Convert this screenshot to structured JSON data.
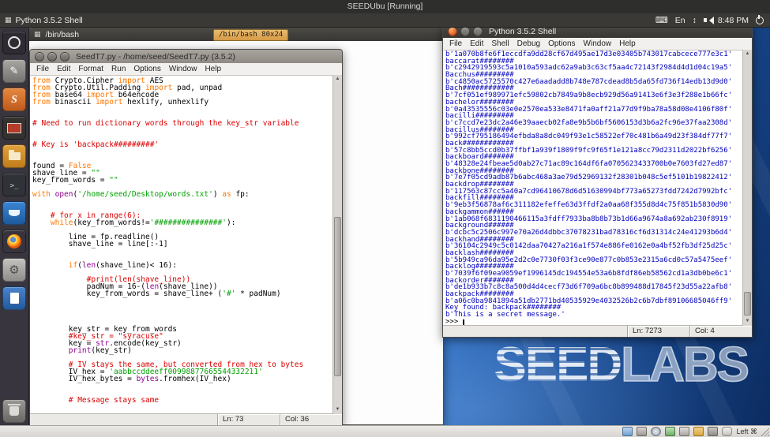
{
  "colors": {
    "kw": "#ff7700",
    "str": "#00a000",
    "com": "#dd0000",
    "blt": "#900090",
    "stdout": "#0000bb"
  },
  "icons": {
    "grid": "▦",
    "keyboard": "⌨",
    "updown": "↕",
    "arrow_up": "▲",
    "arrow_down": "▼"
  },
  "vbox": {
    "title": "SEEDUbu [Running]",
    "status_icons": [
      "display",
      "hdd",
      "cd",
      "network",
      "usb",
      "shared-folder",
      "webcam",
      "mouse"
    ],
    "input_label": "Left ⌘"
  },
  "panel": {
    "active_app": "Python 3.5.2 Shell",
    "language": "En",
    "time": "8:48 PM"
  },
  "launcher": {
    "items": [
      "dash-home",
      "text-editor",
      "seed-app",
      "code-editor",
      "files",
      "terminal",
      "wireshark",
      "firefox",
      "settings",
      "libreoffice",
      "trash"
    ]
  },
  "desktop": {
    "logo_left": "SEED",
    "logo_right": "LABS"
  },
  "terminal": {
    "title": "/bin/bash",
    "resize_tooltip": "/bin/bash 80x24"
  },
  "editor": {
    "title": "SeedT7.py - /home/seed/SeedT7.py (3.5.2)",
    "menus": [
      "File",
      "Edit",
      "Format",
      "Run",
      "Options",
      "Window",
      "Help"
    ],
    "status_line": "Ln: 73",
    "status_col": "Col: 36",
    "code_lines": [
      [
        [
          "from ",
          "k"
        ],
        [
          "Crypto.Cipher ",
          "p"
        ],
        [
          "import ",
          "k"
        ],
        [
          "AES",
          "p"
        ]
      ],
      [
        [
          "from ",
          "k"
        ],
        [
          "Crypto.Util.Padding ",
          "p"
        ],
        [
          "import ",
          "k"
        ],
        [
          "pad, unpad",
          "p"
        ]
      ],
      [
        [
          "from ",
          "k"
        ],
        [
          "base64 ",
          "p"
        ],
        [
          "import ",
          "k"
        ],
        [
          "b64encode",
          "p"
        ]
      ],
      [
        [
          "from ",
          "k"
        ],
        [
          "binascii ",
          "p"
        ],
        [
          "import ",
          "k"
        ],
        [
          "hexlify, unhexlify",
          "p"
        ]
      ],
      [],
      [],
      [
        [
          "# Need to run dictionary words through the key_str variable",
          "c"
        ]
      ],
      [],
      [],
      [
        [
          "# Key is 'backpack#########'",
          "c"
        ]
      ],
      [],
      [],
      [
        [
          "found = ",
          "p"
        ],
        [
          "False",
          "k"
        ]
      ],
      [
        [
          "shave_line = ",
          "p"
        ],
        [
          "\"\"",
          "s"
        ]
      ],
      [
        [
          "key_from_words = ",
          "p"
        ],
        [
          "\"\"",
          "s"
        ]
      ],
      [],
      [
        [
          "with ",
          "k"
        ],
        [
          "open",
          "b"
        ],
        [
          "(",
          "p"
        ],
        [
          "'/home/seed/Desktop/words.txt'",
          "s"
        ],
        [
          ") ",
          "p"
        ],
        [
          "as ",
          "k"
        ],
        [
          "fp:",
          "p"
        ]
      ],
      [],
      [],
      [
        [
          "    ",
          "p"
        ],
        [
          "# for x in range(6):",
          "c"
        ]
      ],
      [
        [
          "    ",
          "p"
        ],
        [
          "while",
          "k"
        ],
        [
          "(key_from_words!=",
          "p"
        ],
        [
          "'###############'",
          "s"
        ],
        [
          "):",
          "p"
        ]
      ],
      [],
      [
        [
          "        line = fp.readline()",
          "p"
        ]
      ],
      [
        [
          "        shave_line = line[:-1]",
          "p"
        ]
      ],
      [],
      [],
      [
        [
          "        ",
          "p"
        ],
        [
          "if",
          "k"
        ],
        [
          "(",
          "p"
        ],
        [
          "len",
          "b"
        ],
        [
          "(shave_line)< 16):",
          "p"
        ]
      ],
      [],
      [
        [
          "            ",
          "p"
        ],
        [
          "#print(len(shave_line))",
          "c"
        ]
      ],
      [
        [
          "            padNum = 16-(",
          "p"
        ],
        [
          "len",
          "b"
        ],
        [
          "(shave_line))",
          "p"
        ]
      ],
      [
        [
          "            key_from_words = shave_line+ (",
          "p"
        ],
        [
          "'#'",
          "s"
        ],
        [
          " * padNum)",
          "p"
        ]
      ],
      [],
      [],
      [],
      [],
      [
        [
          "        key_str = key_from_words",
          "p"
        ]
      ],
      [
        [
          "        ",
          "p"
        ],
        [
          "#key_str = \"syracuse\"",
          "c"
        ]
      ],
      [
        [
          "        key = ",
          "p"
        ],
        [
          "str",
          "b"
        ],
        [
          ".encode(key_str)",
          "p"
        ]
      ],
      [
        [
          "        ",
          "p"
        ],
        [
          "print",
          "b"
        ],
        [
          "(key_str)",
          "p"
        ]
      ],
      [],
      [
        [
          "        ",
          "p"
        ],
        [
          "# IV stays the same, but converted from hex to bytes",
          "c"
        ]
      ],
      [
        [
          "        IV_hex = ",
          "p"
        ],
        [
          "'aabbccddeeff00998877665544332211'",
          "s"
        ]
      ],
      [
        [
          "        IV_hex_bytes = ",
          "p"
        ],
        [
          "bytes",
          "b"
        ],
        [
          ".fromhex(IV_hex)",
          "p"
        ]
      ],
      [],
      [],
      [
        [
          "        # Message stays same",
          "c"
        ]
      ]
    ]
  },
  "shell": {
    "title": "Python 3.5.2 Shell",
    "menus": [
      "File",
      "Edit",
      "Shell",
      "Debug",
      "Options",
      "Window",
      "Help"
    ],
    "status_line": "Ln: 7273",
    "status_col": "Col: 4",
    "prompt": ">>>",
    "output_lines": [
      "b'1a070b8fe6f1eccdfa9dd28cf67d495ae17d3e03405b743017cabcece777e3c1'",
      "baccarat########",
      "b'c2942919593c5a1010a593adc62a9ab3c63cf5aa4c72143f2984d4d1d04c19a5'",
      "Bacchus#########",
      "b'c4850ac5725570c427e6aadadd8b748e787cdead8b5da65fd736f14edb13d9d0'",
      "Bach############",
      "b'7cf051ef989971efc59802cb7849a9b8ecb929d56a91413e6f3e3f288e1b66fc'",
      "bachelor########",
      "b'0a43535556c03e0e2570ea533e8471fa0aff21a77d9f9ba78a58d08e4106f80f'",
      "bacilli#########",
      "b'c7ccd7e23dc2a46e39aaecb02fa8e9b5b6bf5606153d3b6a2fc96e37faa2308d'",
      "bacillus########",
      "b'992cf795186494efbda8a8dc049f93e1c58522ef70c481b6a49d23f384df77f7'",
      "back############",
      "b'57c8bb5ccd0b37ffbf1a939f1809f9fc9f65f1e121a8cc79d2311d2022bf6256'",
      "backboard#######",
      "b'48328e24fbeae5d0ab27c71ac89c164df6fa0705623433700b0e7603fd27ed87'",
      "backbone########",
      "b'7e7f05cd9adb87b6abc468a3ae79d52969132f28301b048c5ef5101b19822412'",
      "backdrop########",
      "b'117563c87cc5a40a7cd96410678d6d51630994bf773a65273fdd7242d7992bfc'",
      "backfill########",
      "b'9eb3f56878af6c311182efeffe63d3ffdf2a0aa68f355d8d4c75f851b5830d90'",
      "backgammon######",
      "b'1ab068f6831190466115a3fdff7933ba8b8b73b1d66a9674a8a692ab230f8919'",
      "background######",
      "b'dcbc5c2506c997e70a26d4dbbc37078231bad78316cf6d31314c24e41293b6d4'",
      "backhand########",
      "b'36104c2949c5c0142daa70427a216a1f574e886fe0162e0a4bf52fb3df25d25c'",
      "backlash########",
      "b'5b949ca96da95e2d2c0e7730f03f3ce90e877c0b853e2315a6cd0c57a5475eef'",
      "backlog#########",
      "b'7039f6f09ea9059ef1996145dc194554e53a6b8fdf86eb58562cd1a3db0be6c1'",
      "backorder#######",
      "b'de1b933b7c8c8a500d4d4cecf73d6f709a6bc8b899488d17845f23d55a22afb8'",
      "backpack########",
      "b'a06c0ba9841894a51db2771bd40535929e4032526b2c6b7dbf89106685046ff9'",
      "Key found: backpack########",
      "b'This is a secret message.'"
    ]
  }
}
